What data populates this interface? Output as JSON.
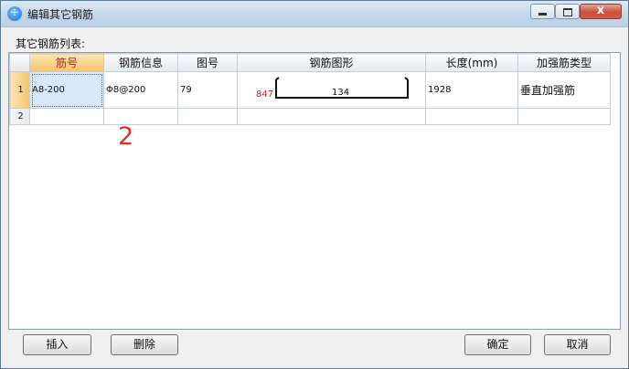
{
  "window": {
    "title": "编辑其它钢筋",
    "app_icon": "glodon-icon",
    "close_glyph": "x"
  },
  "list_label": "其它钢筋列表:",
  "table": {
    "columns": [
      "筋号",
      "钢筋信息",
      "图号",
      "钢筋图形",
      "长度(mm)",
      "加强筋类型"
    ],
    "rows": [
      {
        "num": "1",
        "bar_no": "A8-200",
        "bar_info": "Φ8@200",
        "fig_no": "79",
        "shape": {
          "left_leg": "847",
          "middle": "134"
        },
        "length": "1928",
        "rein_type": "垂直加强筋"
      },
      {
        "num": "2",
        "bar_no": "",
        "bar_info": "",
        "fig_no": "",
        "shape": null,
        "length": "",
        "rein_type": ""
      }
    ]
  },
  "annotation": "2",
  "buttons": {
    "insert": "插入",
    "delete": "删除",
    "ok": "确定",
    "cancel": "取消"
  },
  "colors": {
    "active_header": "#f5c56c",
    "annotation": "#e0322b",
    "shape_label": "#c0262a"
  }
}
